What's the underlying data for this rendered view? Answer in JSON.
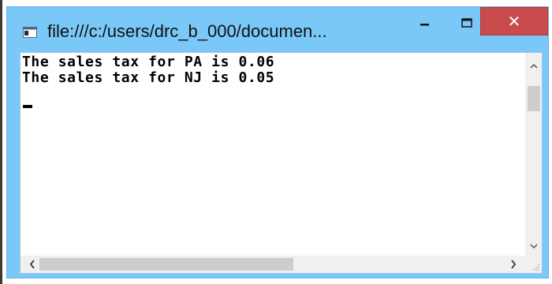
{
  "window": {
    "title": "file:///c:/users/drc_b_000/documen...",
    "close_label": "✕",
    "accent_color": "#7ac8f8",
    "close_color": "#c94b4b"
  },
  "console": {
    "lines": [
      "The sales tax for PA is 0.06",
      "The sales tax for NJ is 0.05"
    ]
  },
  "icons": {
    "app": "console-app-icon",
    "minimize": "minimize-icon",
    "maximize": "maximize-icon",
    "close": "close-icon",
    "scroll_up": "chevron-up-icon",
    "scroll_down": "chevron-down-icon",
    "scroll_left": "chevron-left-icon",
    "scroll_right": "chevron-right-icon"
  }
}
